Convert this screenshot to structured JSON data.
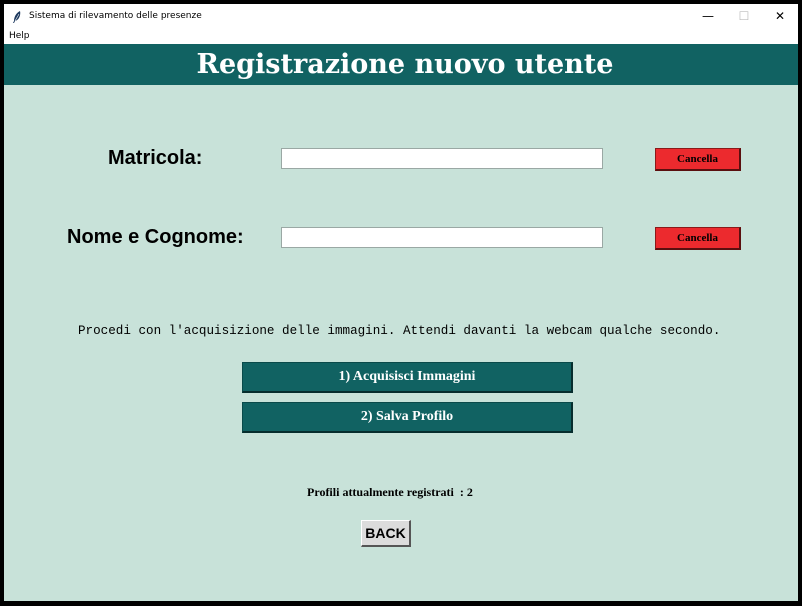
{
  "window": {
    "title": "Sistema di rilevamento delle presenze",
    "controls": {
      "minimize": "—",
      "maximize": "☐",
      "close": "✕"
    }
  },
  "menu": {
    "items": [
      "Help"
    ]
  },
  "header": {
    "title": "Registrazione nuovo utente",
    "bg_color": "#116262"
  },
  "form": {
    "matricola": {
      "label": "Matricola:",
      "value": "",
      "clear_label": "Cancella"
    },
    "nome": {
      "label": "Nome e Cognome:",
      "value": "",
      "clear_label": "Cancella"
    }
  },
  "instruction": "Procedi con l'acquisizione delle immagini. Attendi davanti la webcam qualche secondo.",
  "actions": {
    "acquire_label": "1)  Acquisisci Immagini",
    "save_label": "2)  Salva Profilo"
  },
  "status": {
    "profiles_text": "Profili attualmente registrati  : 2"
  },
  "back_label": "BACK",
  "colors": {
    "background": "#c8e2d9",
    "accent": "#116262",
    "danger": "#ec2a2e"
  }
}
